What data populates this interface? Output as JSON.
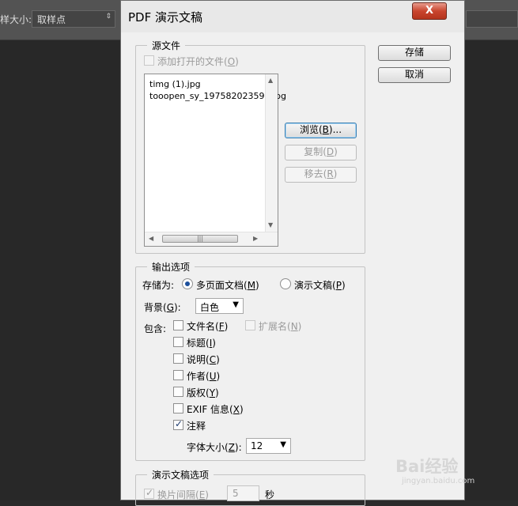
{
  "app_bar": {
    "size_label": "样大小:",
    "sample_select": "取样点"
  },
  "dialog": {
    "title": "PDF 演示文稿",
    "close": "X",
    "source": {
      "legend": "源文件",
      "add_open": "添加打开的文件(",
      "add_open_key": "O",
      "files": [
        "timg (1).jpg",
        "tooopen_sy_197582023591.jpg"
      ],
      "browse": "浏览(",
      "browse_key": "B",
      "browse_tail": ")...",
      "copy": "复制(",
      "copy_key": "D",
      "remove": "移去(",
      "remove_key": "R"
    },
    "buttons": {
      "save": "存储",
      "cancel": "取消"
    },
    "output": {
      "legend": "输出选项",
      "save_as_label": "存储为:",
      "multipage": "多页面文档(",
      "multipage_key": "M",
      "presentation": "演示文稿(",
      "presentation_key": "P",
      "background_label": "背景(",
      "background_key": "G",
      "background_value": "白色",
      "include_label": "包含:",
      "filename": "文件名(",
      "filename_key": "F",
      "extension": "扩展名(",
      "extension_key": "N",
      "title_opt": "标题(",
      "title_key": "I",
      "description": "说明(",
      "description_key": "C",
      "author": "作者(",
      "author_key": "U",
      "copyright": "版权(",
      "copyright_key": "Y",
      "exif": "EXIF 信息(",
      "exif_key": "X",
      "annotation": "注释",
      "annotation_checked": true,
      "font_size_label": "字体大小(",
      "font_size_key": "Z",
      "font_size_value": "12"
    },
    "presentation_opts": {
      "legend": "演示文稿选项",
      "advance": "换片间隔(",
      "advance_key": "E",
      "advance_value": "5",
      "seconds": "秒"
    }
  },
  "watermark": {
    "brand": "Bai经验",
    "url": "jingyan.baidu.com"
  }
}
